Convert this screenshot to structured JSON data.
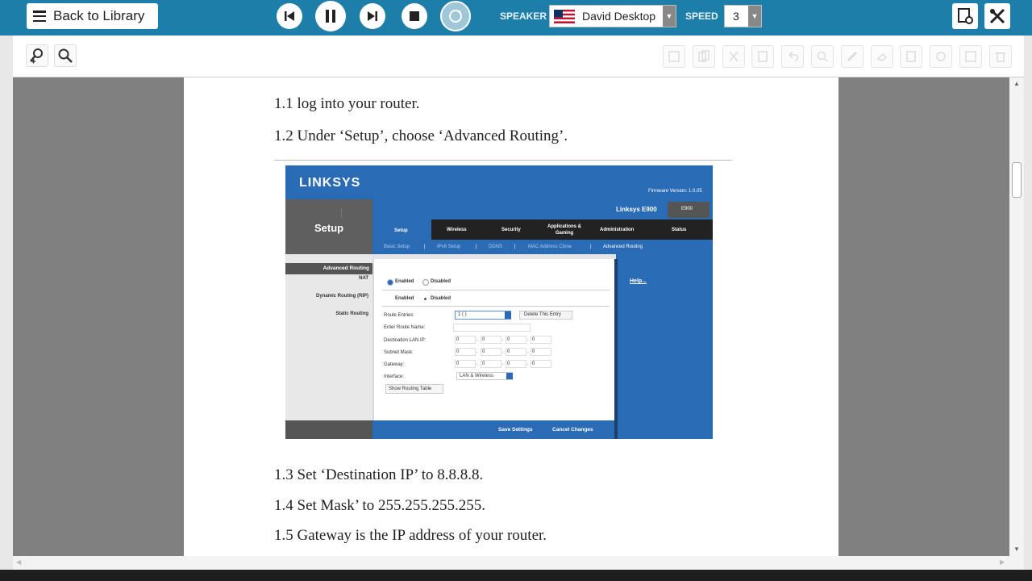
{
  "topbar": {
    "back_label": "Back to Library",
    "speaker_label": "SPEAKER",
    "speaker_value": "David Desktop",
    "speed_label": "SPEED",
    "speed_value": "3"
  },
  "document": {
    "lines": [
      "1.1 log into your router.",
      "1.2 Under ‘Setup’, choose ‘Advanced Routing’.",
      "1.3 Set ‘Destination IP’ to 8.8.8.8.",
      "1.4 Set Mask’ to 255.255.255.255.",
      "1.5 Gateway is the IP address of your router."
    ]
  },
  "router": {
    "brand": "LINKSYS",
    "firmware": "Firmware Version: 1.0.05",
    "model": "Linksys E900",
    "model_short": "E900",
    "section": "Setup",
    "tabs": [
      "Setup",
      "Wireless",
      "Security",
      "Applications & Gaming",
      "Administration",
      "Status"
    ],
    "subtabs": [
      "Basic Setup",
      "|",
      "IPv6 Setup",
      "|",
      "DDNS",
      "|",
      "MAC Address Clone",
      "|",
      "Advanced Routing"
    ],
    "side": {
      "heading": "Advanced Routing",
      "nat": "NAT",
      "dynamic": "Dynamic Routing (RIP)",
      "static": "Static Routing"
    },
    "enabled": "Enabled",
    "disabled": "Disabled",
    "route_entries_label": "Route Entries:",
    "route_entries_value": "1 ( )",
    "delete_entry": "Delete This Entry",
    "route_name_label": "Enter Route Name:",
    "dest_label": "Destination LAN IP:",
    "mask_label": "Subnet Mask:",
    "gateway_label": "Gateway:",
    "interface_label": "Interface:",
    "interface_value": "LAN & Wireless",
    "octet": "0",
    "show_table": "Show Routing Table",
    "help": "Help...",
    "save": "Save Settings",
    "cancel": "Cancel Changes"
  }
}
